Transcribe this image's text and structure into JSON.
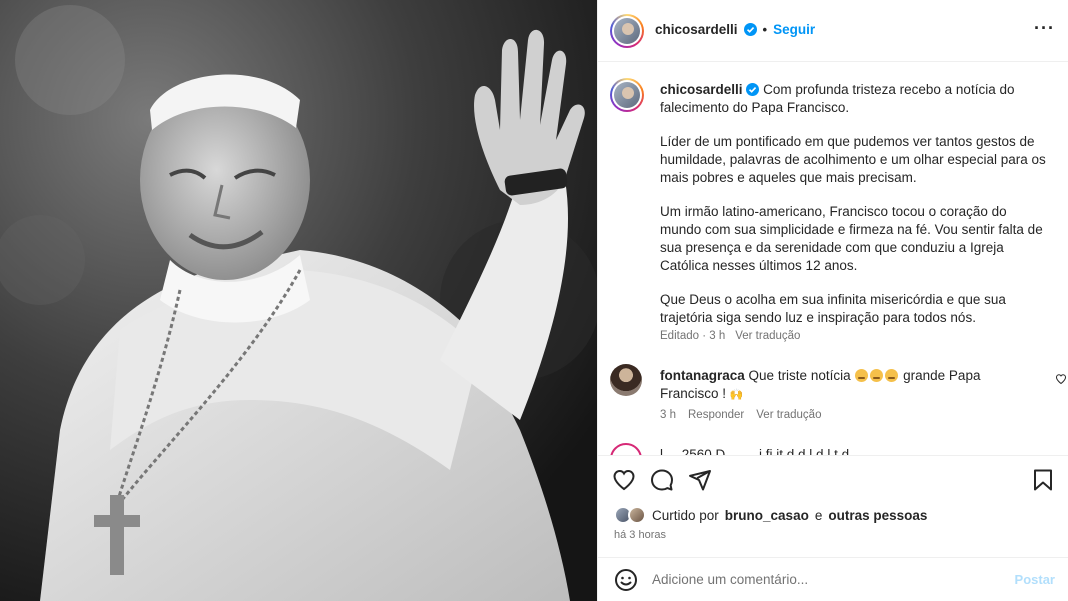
{
  "post": {
    "username": "chicosardelli",
    "separator": "•",
    "follow_label": "Seguir",
    "more_icon": "more-horizontal-icon"
  },
  "caption": {
    "username": "chicosardelli",
    "paragraphs": [
      "Com profunda tristeza recebo a notícia do falecimento do Papa Francisco.",
      "Líder de um pontificado em que pudemos ver tantos gestos de humildade, palavras de acolhimento e um olhar especial para os mais pobres e aqueles que mais precisam.",
      "Um irmão latino-americano, Francisco tocou o coração do mundo com sua simplicidade e firmeza na fé. Vou sentir falta de sua presença e da serenidade com que conduziu a Igreja Católica nesses últimos 12 anos.",
      "Que Deus o acolha em sua infinita misericórdia e que sua trajetória siga sendo luz e inspiração para todos nós."
    ],
    "meta_edited": "Editado · 3 h",
    "meta_translate": "Ver tradução"
  },
  "comments": [
    {
      "username": "fontanagraca",
      "text_a": "Que triste notícia",
      "text_b": "grande Papa Francisco !",
      "time": "3 h",
      "reply_label": "Responder",
      "translate_label": "Ver tradução"
    },
    {
      "text_partial": "l ... 2560 D  ...   ...  i fi it  d   d  l   d  l t d"
    }
  ],
  "actions": {
    "liked_prefix": "Curtido por",
    "liked_user": "bruno_casao",
    "liked_connector": "e",
    "liked_others": "outras pessoas",
    "time_ago": "há 3 horas"
  },
  "add_comment": {
    "placeholder": "Adicione um comentário...",
    "post_label": "Postar"
  },
  "colors": {
    "accent_blue": "#0095f6",
    "text": "#262626",
    "muted": "#737373",
    "post_disabled": "#b2dffc"
  }
}
